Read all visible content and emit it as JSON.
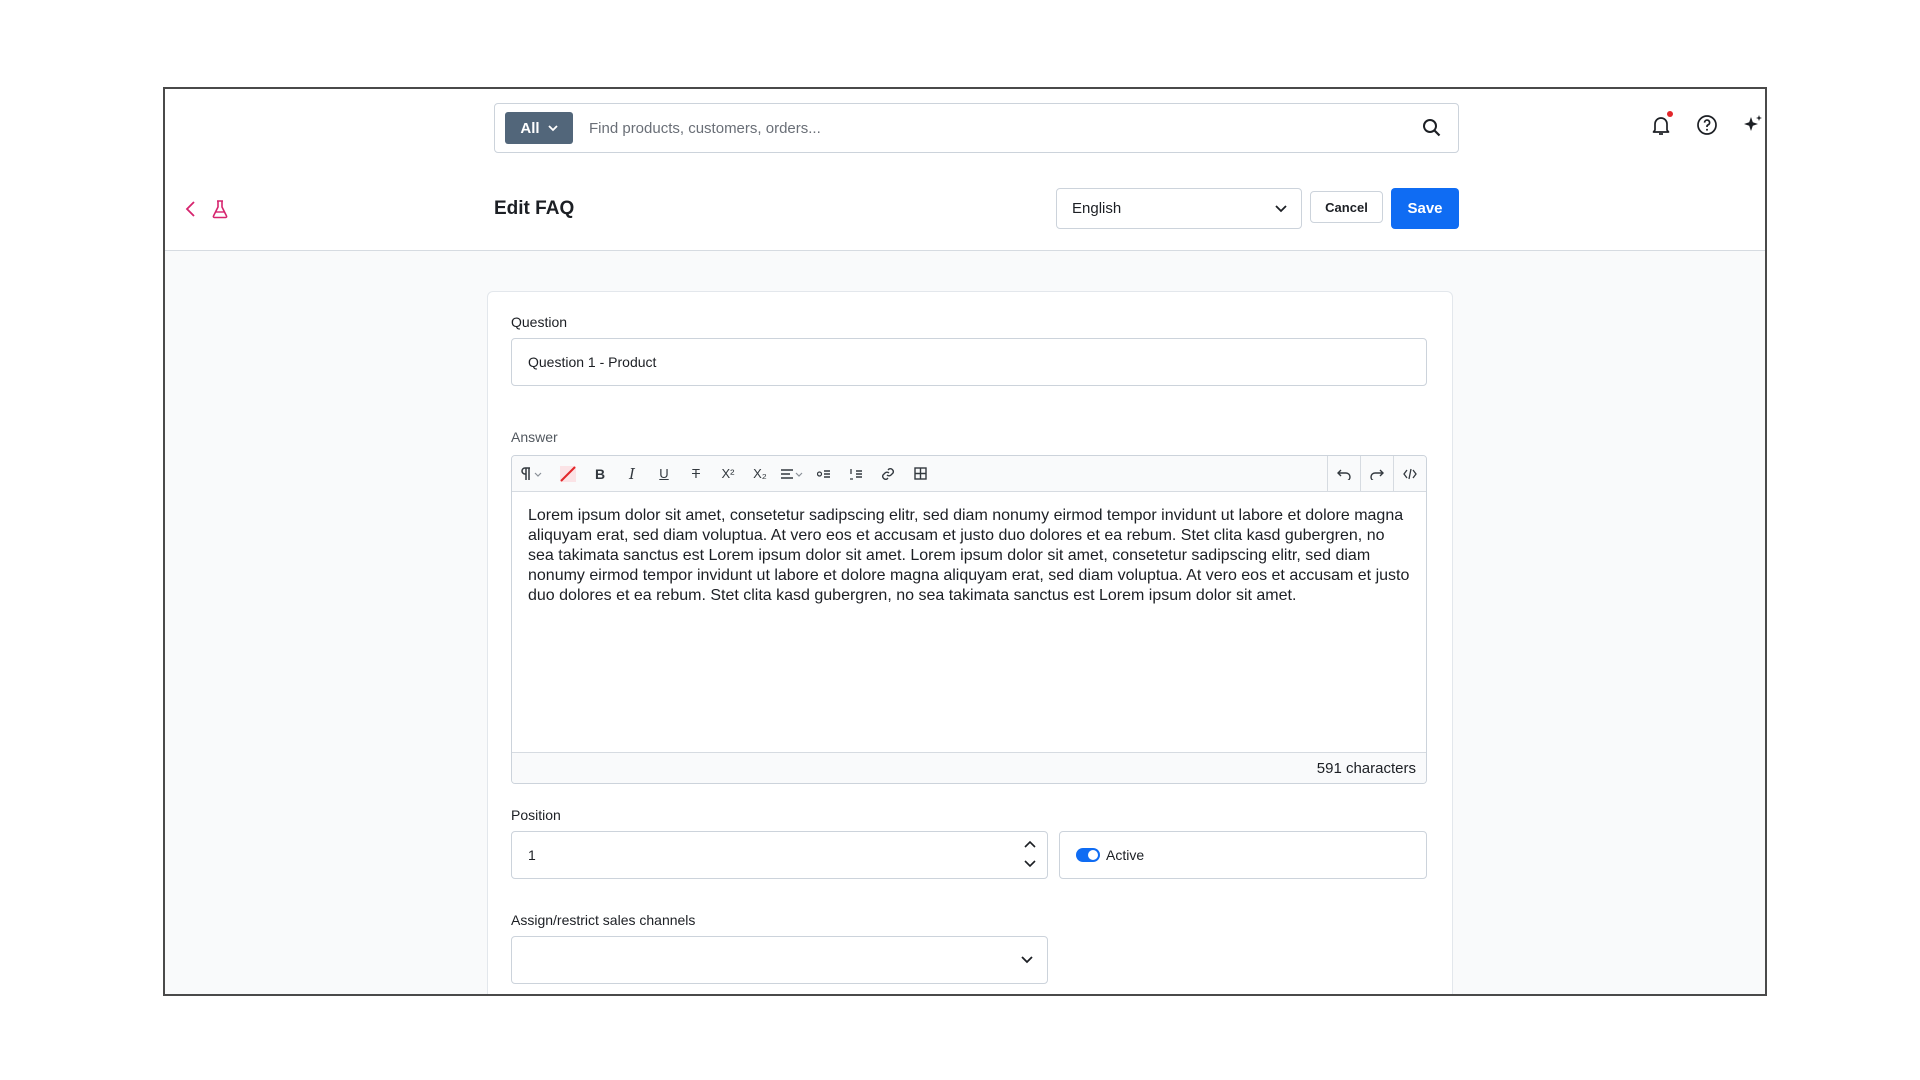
{
  "search": {
    "scope_label": "All",
    "placeholder": "Find products, customers, orders..."
  },
  "header": {
    "title": "Edit FAQ",
    "language": "English",
    "cancel_label": "Cancel",
    "save_label": "Save"
  },
  "form": {
    "question_label": "Question",
    "question_value": "Question 1 - Product",
    "answer_label": "Answer",
    "answer_text": "Lorem ipsum dolor sit amet, consetetur sadipscing elitr, sed diam nonumy eirmod tempor invidunt ut labore et dolore magna aliquyam erat, sed diam voluptua. At vero eos et accusam et justo duo dolores et ea rebum. Stet clita kasd gubergren, no sea takimata sanctus est Lorem ipsum dolor sit amet. Lorem ipsum dolor sit amet, consetetur sadipscing elitr, sed diam nonumy eirmod tempor invidunt ut labore et dolore magna aliquyam erat, sed diam voluptua. At vero eos et accusam et justo duo dolores et ea rebum. Stet clita kasd gubergren, no sea takimata sanctus est Lorem ipsum dolor sit amet.",
    "char_count": "591 characters",
    "position_label": "Position",
    "position_value": "1",
    "active_label": "Active",
    "channels_label": "Assign/restrict sales channels"
  },
  "toolbar": {
    "superscript": "X²",
    "subscript": "X₂"
  },
  "colors": {
    "accent": "#0f6cf3",
    "scope_bg": "#52667a",
    "brand_pink": "#d6246e",
    "notification": "#e2262a"
  }
}
